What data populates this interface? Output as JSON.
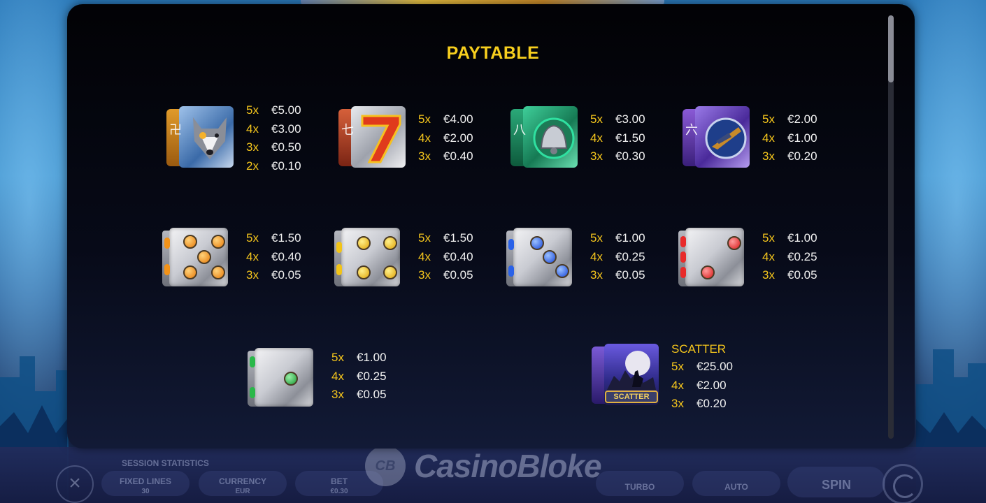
{
  "paytable": {
    "title": "PAYTABLE",
    "symbols": [
      {
        "name": "wolf",
        "icon": "wolf-icon",
        "pays": [
          [
            "5x",
            "€5.00"
          ],
          [
            "4x",
            "€3.00"
          ],
          [
            "3x",
            "€0.50"
          ],
          [
            "2x",
            "€0.10"
          ]
        ]
      },
      {
        "name": "seven",
        "icon": "seven-icon",
        "pays": [
          [
            "5x",
            "€4.00"
          ],
          [
            "4x",
            "€2.00"
          ],
          [
            "3x",
            "€0.40"
          ]
        ]
      },
      {
        "name": "bell",
        "icon": "bell-icon",
        "pays": [
          [
            "5x",
            "€3.00"
          ],
          [
            "4x",
            "€1.50"
          ],
          [
            "3x",
            "€0.30"
          ]
        ]
      },
      {
        "name": "spaceship",
        "icon": "spaceship-icon",
        "pays": [
          [
            "5x",
            "€2.00"
          ],
          [
            "4x",
            "€1.00"
          ],
          [
            "3x",
            "€0.20"
          ]
        ]
      },
      {
        "name": "orange-die",
        "icon": "orange-die-icon",
        "pays": [
          [
            "5x",
            "€1.50"
          ],
          [
            "4x",
            "€0.40"
          ],
          [
            "3x",
            "€0.05"
          ]
        ]
      },
      {
        "name": "yellow-die",
        "icon": "yellow-die-icon",
        "pays": [
          [
            "5x",
            "€1.50"
          ],
          [
            "4x",
            "€0.40"
          ],
          [
            "3x",
            "€0.05"
          ]
        ]
      },
      {
        "name": "blue-die",
        "icon": "blue-die-icon",
        "pays": [
          [
            "5x",
            "€1.00"
          ],
          [
            "4x",
            "€0.25"
          ],
          [
            "3x",
            "€0.05"
          ]
        ]
      },
      {
        "name": "red-die",
        "icon": "red-die-icon",
        "pays": [
          [
            "5x",
            "€1.00"
          ],
          [
            "4x",
            "€0.25"
          ],
          [
            "3x",
            "€0.05"
          ]
        ]
      },
      {
        "name": "green-die",
        "icon": "green-die-icon",
        "pays": [
          [
            "5x",
            "€1.00"
          ],
          [
            "4x",
            "€0.25"
          ],
          [
            "3x",
            "€0.05"
          ]
        ]
      },
      {
        "name": "scatter",
        "icon": "scatter-icon",
        "label": "SCATTER",
        "badge": "SCATTER",
        "pays": [
          [
            "5x",
            "€25.00"
          ],
          [
            "4x",
            "€2.00"
          ],
          [
            "3x",
            "€0.20"
          ]
        ]
      }
    ]
  },
  "bottom_bar": {
    "session_statistics": "SESSION STATISTICS",
    "fixed_lines": "FIXED LINES",
    "fixed_lines_value": "30",
    "currency": "CURRENCY",
    "currency_value": "EUR",
    "bet": "BET",
    "bet_value": "€0.30",
    "turbo": "TURBO",
    "auto": "AUTO",
    "spin": "SPIN"
  },
  "watermark": {
    "logo": "CB",
    "text": "CasinoBloke"
  },
  "colors": {
    "accent": "#f7cf1e",
    "modal_bg": "#03040a",
    "value_text": "#f2f2f2"
  }
}
